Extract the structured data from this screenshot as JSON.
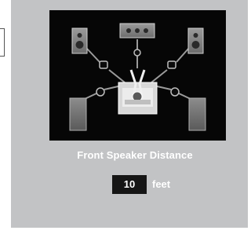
{
  "setting": {
    "title": "Front Speaker Distance",
    "value": "10",
    "unit": "feet"
  },
  "icons": {
    "diagram": "speaker-layout-diagram"
  },
  "colors": {
    "panel": "#c2c3c5",
    "diagram_background": "#060606",
    "value_box": "#151515",
    "text": "#ffffff"
  }
}
